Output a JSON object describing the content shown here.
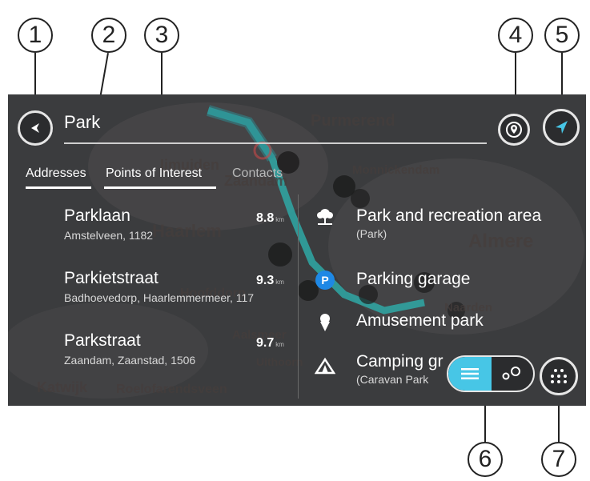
{
  "callouts": [
    "1",
    "2",
    "3",
    "4",
    "5",
    "6",
    "7"
  ],
  "search": {
    "query": "Park"
  },
  "tabs": [
    {
      "label": "Addresses",
      "active": true
    },
    {
      "label": "Points of Interest",
      "active": true
    },
    {
      "label": "Contacts",
      "active": false
    }
  ],
  "addresses": [
    {
      "name": "Parklaan",
      "detail": "Amstelveen, 1182",
      "distance": "8.8",
      "unit": "km"
    },
    {
      "name": "Parkietstraat",
      "detail": "Badhoevedorp, Haarlemmermeer, 117",
      "distance": "9.3",
      "unit": "km"
    },
    {
      "name": "Parkstraat",
      "detail": "Zaandam, Zaanstad, 1506",
      "distance": "9.7",
      "unit": "km"
    }
  ],
  "poi_categories": [
    {
      "name": "Park and recreation area",
      "detail": "(Park)",
      "icon": "tree-icon"
    },
    {
      "name": "Parking garage",
      "detail": "",
      "icon": "parking-icon"
    },
    {
      "name": "Amusement park",
      "detail": "",
      "icon": "ice-cream-icon"
    },
    {
      "name": "Camping gr",
      "detail": "(Caravan Park",
      "icon": "tent-icon"
    }
  ],
  "map_labels": [
    "Purmerend",
    "Ijmuiden",
    "Zaandam",
    "Monnickendam",
    "Almere",
    "Haarlem",
    "Hoofddorp",
    "Aalsmeer",
    "Naarden",
    "Uithoorn",
    "Katwijk",
    "Roelofarendsveen"
  ],
  "colors": {
    "accent": "#47c6e6",
    "parking_badge": "#1e88e5",
    "route": "#2fb5b0",
    "background": "#3a3b3d"
  }
}
